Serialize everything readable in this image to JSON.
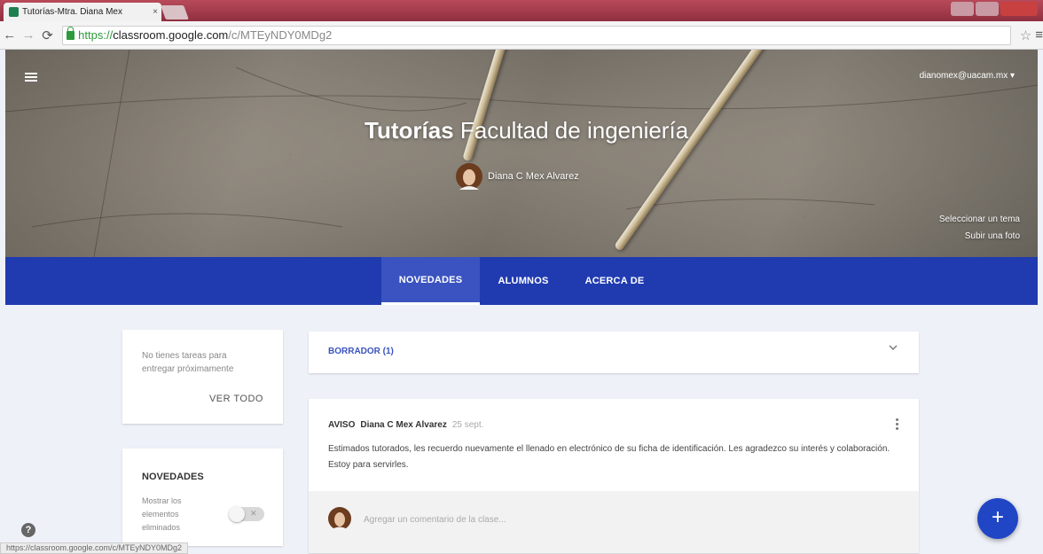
{
  "browser": {
    "tab_title": "Tutorías-Mtra. Diana Mex",
    "tab_close": "×",
    "url_scheme": "https://",
    "url_host": "classroom.google.com",
    "url_path": "/c/MTEyNDY0MDg2",
    "status_url": "https://classroom.google.com/c/MTEyNDY0MDg2"
  },
  "banner": {
    "account": "dianomex@uacam.mx ▾",
    "title_bold": "Tutorías",
    "title_rest": " Facultad de ingeniería",
    "teacher_name": "Diana C Mex Alvarez",
    "select_theme": "Seleccionar un tema",
    "upload_photo": "Subir una foto"
  },
  "nav": {
    "tabs": [
      {
        "label": "NOVEDADES",
        "active": true
      },
      {
        "label": "ALUMNOS",
        "active": false
      },
      {
        "label": "ACERCA DE",
        "active": false
      }
    ]
  },
  "upcoming": {
    "message": "No tienes tareas para entregar próximamente",
    "view_all": "VER TODO"
  },
  "stream_settings": {
    "header": "NOVEDADES",
    "option": "Mostrar los elementos eliminados",
    "toggle_state": "off"
  },
  "draft": {
    "label": "BORRADOR (1)"
  },
  "post": {
    "type": "AVISO",
    "author": "Diana C Mex Alvarez",
    "date": "25 sept.",
    "body": "Estimados tutorados, les recuerdo nuevamente el llenado en electrónico de su ficha de identificación. Les agradezco su interés y colaboración. Estoy para servirles.",
    "comment_placeholder": "Agregar un comentario de la clase..."
  },
  "fab_label": "+",
  "help_label": "?",
  "colors": {
    "navbar": "#203bb0",
    "fab": "#2046c6",
    "accent_text": "#3a53c0"
  }
}
